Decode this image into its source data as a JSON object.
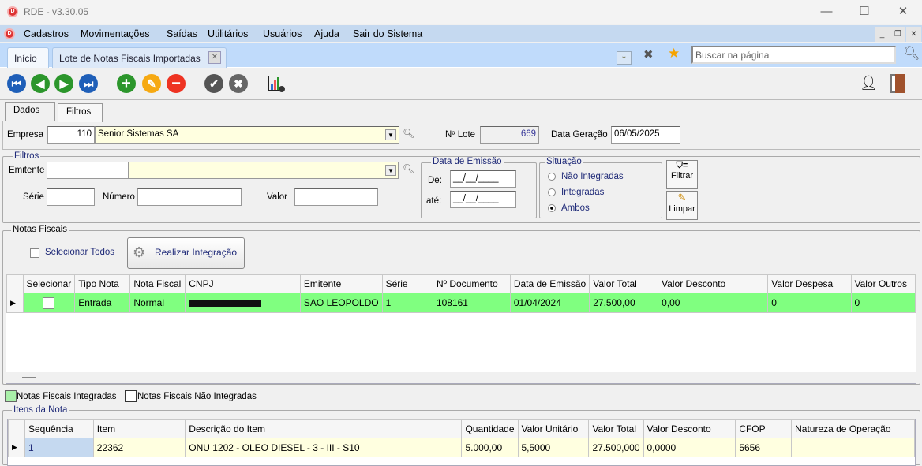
{
  "window": {
    "title": "RDE - v3.30.05",
    "minimize": "—",
    "maximize": "☐",
    "close": "✕"
  },
  "menu": {
    "items": [
      "Cadastros",
      "Movimentações",
      "Saídas",
      "Utilitários",
      "Usuários",
      "Ajuda",
      "Sair do Sistema"
    ]
  },
  "tabs": {
    "home": "Início",
    "active": "Lote de Notas Fiscais Importadas",
    "search_placeholder": "Buscar na página"
  },
  "toolbar": {
    "icons": [
      "first-icon",
      "previous-icon",
      "next-icon",
      "last-icon",
      "add-icon",
      "edit-icon",
      "delete-icon",
      "confirm-icon",
      "cancel-icon",
      "report-icon",
      "user-security-icon",
      "exit-icon"
    ]
  },
  "page_tabs": [
    "Dados",
    "Filtros"
  ],
  "header": {
    "empresa_label": "Empresa",
    "empresa_code": "110",
    "empresa_name": "Senior Sistemas SA",
    "lote_label": "Nº Lote",
    "lote_value": "669",
    "data_label": "Data Geração",
    "data_value": "06/05/2025"
  },
  "filtros": {
    "title": "Filtros",
    "emitente_label": "Emitente",
    "serie_label": "Série",
    "numero_label": "Número",
    "valor_label": "Valor",
    "data_emissao": {
      "title": "Data de Emissão",
      "de_label": "De:",
      "ate_label": "até:",
      "de_value": "__/__/____",
      "ate_value": "__/__/____"
    },
    "situacao": {
      "title": "Situação",
      "options": [
        "Não Integradas",
        "Integradas",
        "Ambos"
      ],
      "selected": "Ambos"
    },
    "filtrar": "Filtrar",
    "limpar": "Limpar"
  },
  "notas": {
    "title": "Notas Fiscais",
    "select_all": "Selecionar Todos",
    "integrate": "Realizar Integração",
    "columns": [
      "Selecionar",
      "Tipo Nota",
      "Nota Fiscal",
      "CNPJ",
      "Emitente",
      "Série",
      "Nº Documento",
      "Data de Emissão",
      "Valor Total",
      "Valor Desconto",
      "Valor Despesa",
      "Valor Outros"
    ],
    "rows": [
      [
        "",
        "Entrada",
        "Normal",
        "[redacted]",
        "SAO LEOPOLDO",
        "1",
        "108161",
        "01/04/2024",
        "27.500,00",
        "0,00",
        "0",
        "0"
      ]
    ],
    "legend_integradas": "Notas Fiscais Integradas",
    "legend_nao": "Notas Fiscais Não Integradas",
    "integrated_color": "#80ff80"
  },
  "itens": {
    "title": "Itens da Nota",
    "columns": [
      "Sequência",
      "Item",
      "Descrição do Item",
      "Quantidade",
      "Valor Unitário",
      "Valor Total",
      "Valor Desconto",
      "CFOP",
      "Natureza de Operação"
    ],
    "rows": [
      [
        "1",
        "22362",
        "ONU 1202 - OLEO DIESEL - 3 - III - S10",
        "5.000,00",
        "5,5000",
        "27.500,000",
        "0,0000",
        "5656",
        ""
      ]
    ]
  }
}
